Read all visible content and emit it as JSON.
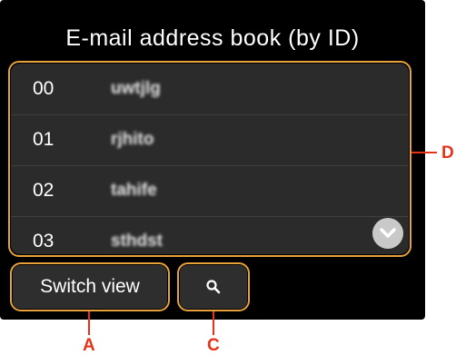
{
  "screen": {
    "title": "E-mail address book (by ID)",
    "entries": [
      {
        "id": "00",
        "name": "uwtjlg"
      },
      {
        "id": "01",
        "name": "rjhito"
      },
      {
        "id": "02",
        "name": "tahife"
      },
      {
        "id": "03",
        "name": "sthdst"
      }
    ],
    "scroll_icon": "chevron-down-icon",
    "buttons": {
      "switch_view": "Switch view",
      "search_icon": "search-icon"
    }
  },
  "annotations": {
    "a": "A",
    "c": "C",
    "d": "D"
  },
  "colors": {
    "screen_bg": "#000000",
    "panel_bg": "#2b2b2b",
    "callout_border": "#e8a23c",
    "marker": "#e63219"
  }
}
